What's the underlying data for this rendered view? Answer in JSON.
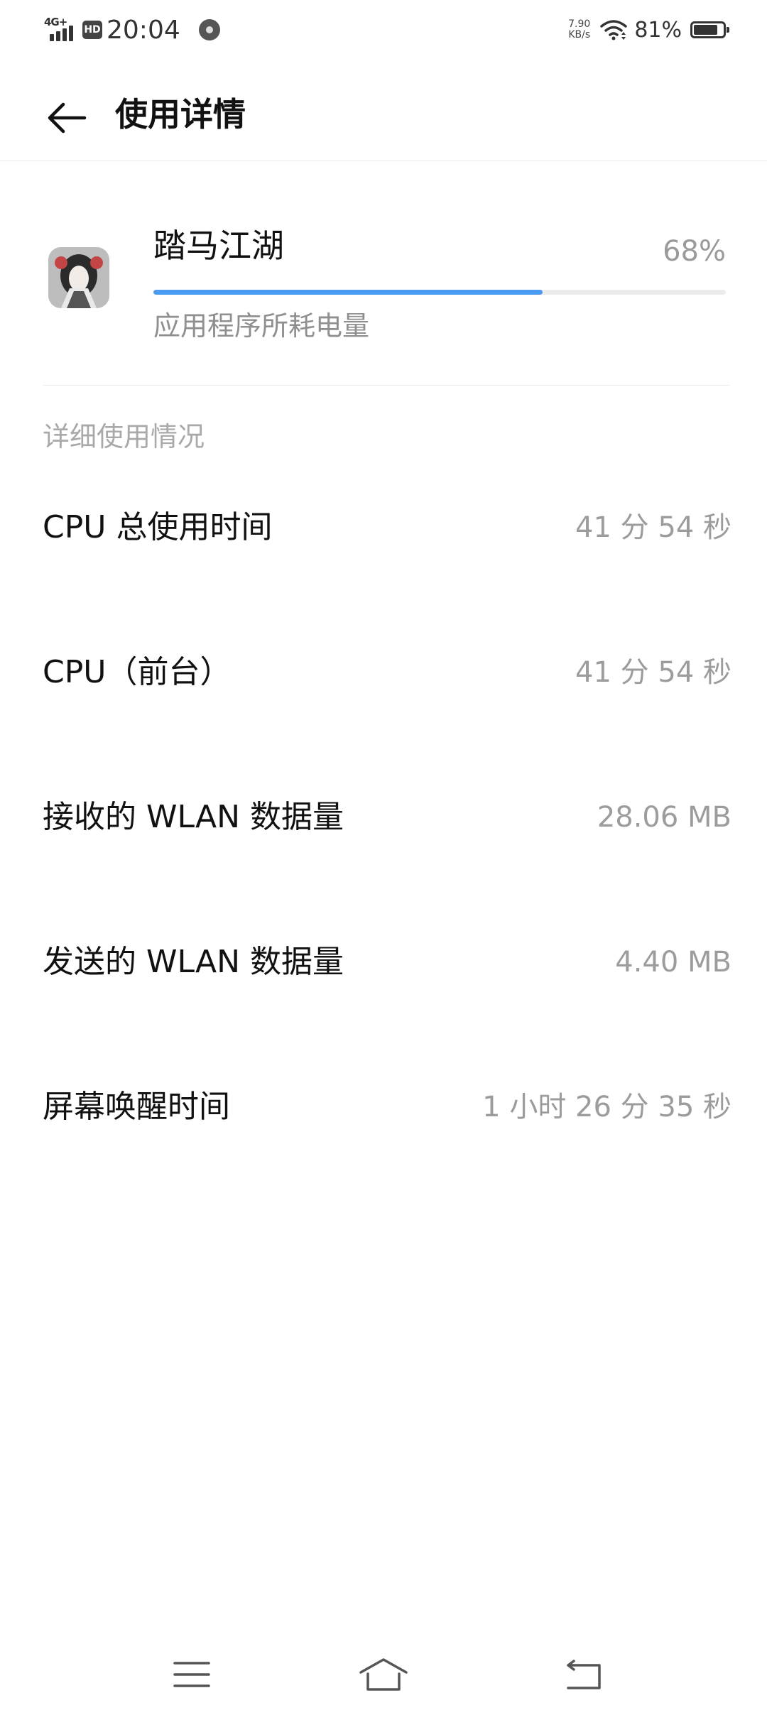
{
  "status_bar": {
    "network_type": "4G+",
    "hd_label": "HD",
    "time": "20:04",
    "net_speed_value": "7.90",
    "net_speed_unit": "KB/s",
    "battery_percent": "81%"
  },
  "header": {
    "title": "使用详情"
  },
  "app": {
    "name": "踏马江湖",
    "percent_label": "68%",
    "percent_value": 0.68,
    "caption": "应用程序所耗电量",
    "progress_color": "#4b9bf0"
  },
  "details": {
    "section_title": "详细使用情况",
    "rows": [
      {
        "label": "CPU 总使用时间",
        "value": "41 分 54 秒"
      },
      {
        "label": "CPU（前台）",
        "value": "41 分 54 秒"
      },
      {
        "label": "接收的 WLAN 数据量",
        "value": "28.06 MB"
      },
      {
        "label": "发送的 WLAN 数据量",
        "value": "4.40 MB"
      },
      {
        "label": "屏幕唤醒时间",
        "value": "1 小时 26 分 35 秒"
      }
    ]
  },
  "nav": {
    "icons": [
      "menu-icon",
      "home-icon",
      "back-icon"
    ]
  }
}
